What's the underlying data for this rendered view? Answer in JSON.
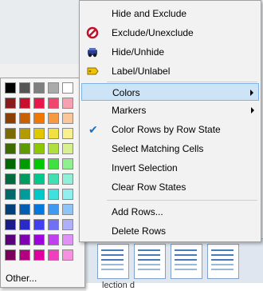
{
  "menu": {
    "items": [
      {
        "label": "Hide and Exclude",
        "icon": "none"
      },
      {
        "label": "Exclude/Unexclude",
        "icon": "exclude-icon"
      },
      {
        "label": "Hide/Unhide",
        "icon": "hide-icon"
      },
      {
        "label": "Label/Unlabel",
        "icon": "label-icon"
      },
      {
        "label": "Colors",
        "submenu": true,
        "selected": true
      },
      {
        "label": "Markers",
        "submenu": true
      },
      {
        "label": "Color Rows by Row State",
        "checked": true
      },
      {
        "label": "Select Matching Cells"
      },
      {
        "label": "Invert Selection"
      },
      {
        "label": "Clear Row States"
      },
      {
        "label": "Add Rows..."
      },
      {
        "label": "Delete Rows"
      }
    ]
  },
  "palette": {
    "other_label": "Other...",
    "rows": [
      [
        "#000000",
        "#555555",
        "#7f7f7f",
        "#aaaaaa",
        "#ffffff"
      ],
      [
        "#8b1a1a",
        "#c8102e",
        "#e8174c",
        "#f0476c",
        "#f7a0b0"
      ],
      [
        "#8a3f00",
        "#c85f00",
        "#f07800",
        "#f59a40",
        "#f9c799"
      ],
      [
        "#7a6a00",
        "#b39b00",
        "#e0c800",
        "#f0e040",
        "#f8f090"
      ],
      [
        "#3f6a00",
        "#5f9b00",
        "#8cc800",
        "#b0e040",
        "#d8f090"
      ],
      [
        "#006a00",
        "#009b00",
        "#00c800",
        "#40e040",
        "#90f090"
      ],
      [
        "#006a3f",
        "#009b5f",
        "#00c88c",
        "#40e0b0",
        "#90f0d8"
      ],
      [
        "#006a6a",
        "#009b9b",
        "#00c8c8",
        "#40e0e0",
        "#90f0f0"
      ],
      [
        "#003f7a",
        "#005fb3",
        "#0078e0",
        "#4099f0",
        "#90c4f8"
      ],
      [
        "#1a1a8b",
        "#2a2ac8",
        "#4040f0",
        "#7070f5",
        "#b0b0fa"
      ],
      [
        "#5a007a",
        "#8000b3",
        "#a000e0",
        "#c040f0",
        "#e090f8"
      ],
      [
        "#7a005a",
        "#b30080",
        "#e000a0",
        "#f040c0",
        "#f890e0"
      ]
    ]
  },
  "background": {
    "strip_text": "lection d"
  }
}
